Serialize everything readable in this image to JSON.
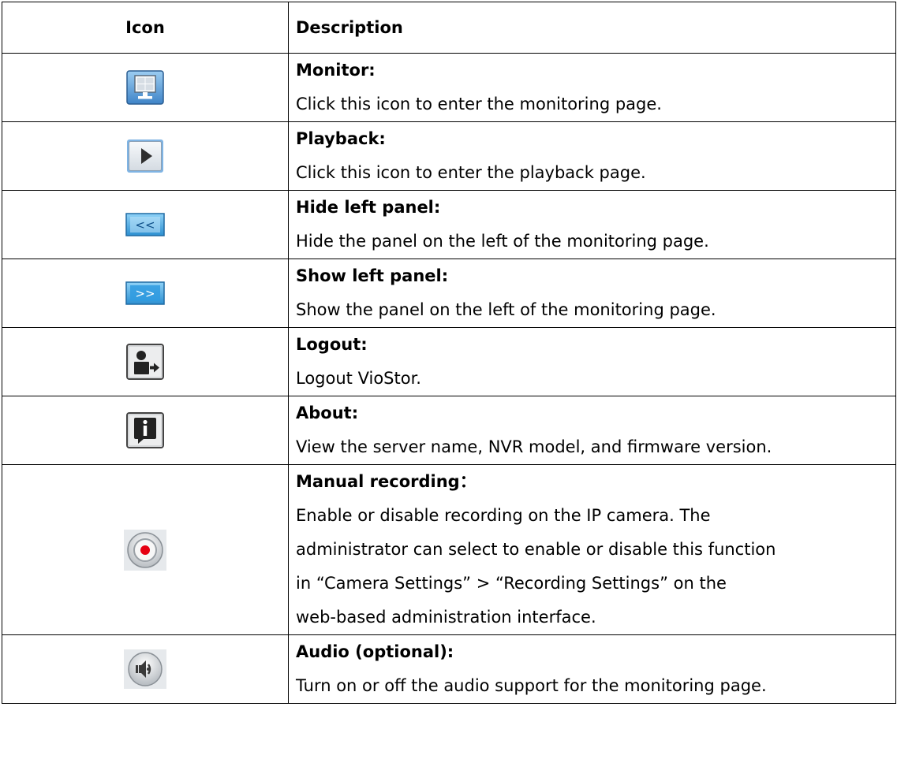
{
  "table": {
    "headers": {
      "icon": "Icon",
      "description": "Description"
    },
    "rows": [
      {
        "icon_name": "monitor-icon",
        "title": "Monitor:",
        "lines": [
          "Click this icon to enter the monitoring page."
        ]
      },
      {
        "icon_name": "playback-icon",
        "title": "Playback:",
        "lines": [
          "Click this icon to enter the playback page."
        ]
      },
      {
        "icon_name": "hide-left-panel-icon",
        "title": "Hide left panel:",
        "lines": [
          "Hide the panel on the left of the monitoring page."
        ]
      },
      {
        "icon_name": "show-left-panel-icon",
        "title": "Show left panel:",
        "lines": [
          "Show the panel on the left of the monitoring page."
        ]
      },
      {
        "icon_name": "logout-icon",
        "title": "Logout:",
        "lines": [
          "Logout VioStor."
        ]
      },
      {
        "icon_name": "about-icon",
        "title": "About:",
        "lines": [
          "View the server name, NVR model, and firmware version."
        ]
      },
      {
        "icon_name": "manual-recording-icon",
        "title": "Manual recording：",
        "lines": [
          "Enable or disable recording on the IP camera.   The",
          "administrator can select to enable or disable this function",
          "in “Camera Settings” > “Recording Settings” on the",
          "web-based administration interface."
        ]
      },
      {
        "icon_name": "audio-icon",
        "title": "Audio (optional):",
        "lines": [
          "Turn on or off the audio support for the monitoring page."
        ]
      }
    ]
  },
  "icon_labels": {
    "hide_panel": "<<",
    "show_panel": ">>"
  },
  "colors": {
    "border": "#000000",
    "icon_blue": "#4a90d9",
    "icon_light_blue": "#cfe6fa",
    "record_red": "#e60012"
  }
}
